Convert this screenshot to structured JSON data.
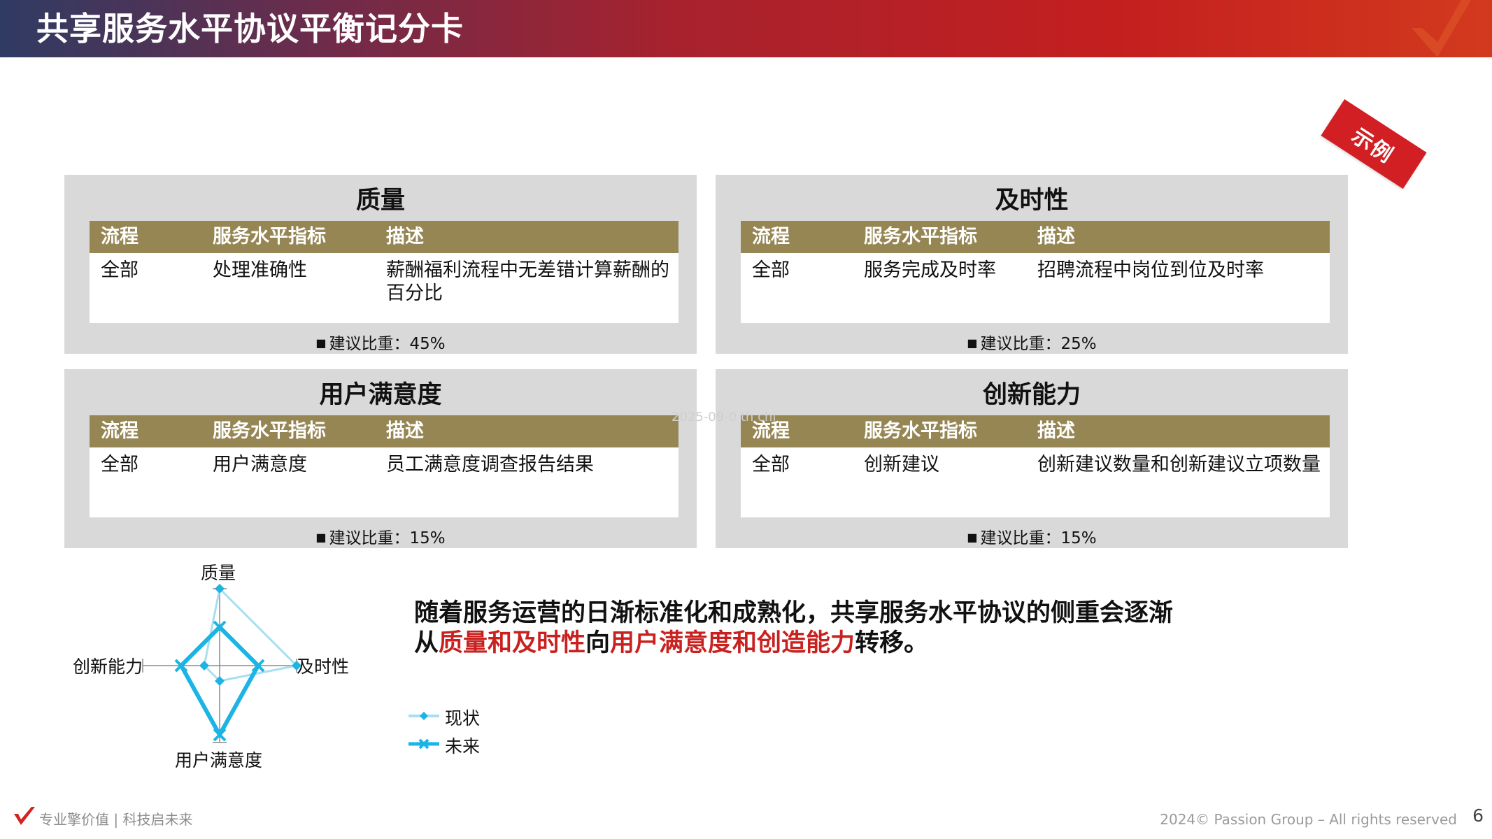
{
  "header": {
    "title": "共享服务水平协议平衡记分卡"
  },
  "stamp": {
    "label": "示例"
  },
  "columns": {
    "process": "流程",
    "indicator": "服务水平指标",
    "description": "描述"
  },
  "cards": [
    {
      "title": "质量",
      "process": "全部",
      "indicator": "处理准确性",
      "description": "薪酬福利流程中无差错计算薪酬的百分比",
      "weight": "建议比重：45%"
    },
    {
      "title": "及时性",
      "process": "全部",
      "indicator": "服务完成及时率",
      "description": "招聘流程中岗位到位及时率",
      "weight": "建议比重：25%"
    },
    {
      "title": "用户满意度",
      "process": "全部",
      "indicator": "用户满意度",
      "description": "员工满意度调查报告结果",
      "weight": "建议比重：15%"
    },
    {
      "title": "创新能力",
      "process": "全部",
      "indicator": "创新建议",
      "description": "创新建议数量和创新建议立项数量",
      "weight": "建议比重：15%"
    }
  ],
  "radar": {
    "axes": {
      "top": "质量",
      "right": "及时性",
      "bottom": "用户满意度",
      "left": "创新能力"
    },
    "series": [
      {
        "name": "现状",
        "color": "#a9def0",
        "marker": "diamond",
        "values": {
          "quality": 1.0,
          "timeliness": 1.0,
          "satisfaction": 0.2,
          "innovation": 0.2
        }
      },
      {
        "name": "未来",
        "color": "#1bb4e4",
        "marker": "x",
        "values": {
          "quality": 0.5,
          "timeliness": 0.5,
          "satisfaction": 0.9,
          "innovation": 0.5
        }
      }
    ]
  },
  "statement": {
    "line1": "随着服务运营的日渐标准化和成熟化，共享服务水平协议的侧重会逐渐",
    "line2_prefix": "从",
    "line2_red1": "质量和及时性",
    "line2_mid": "向",
    "line2_red2": "用户满意度和创造能力",
    "line2_suffix": "转移。"
  },
  "watermark": "2025-09-0 th    chi",
  "footer": {
    "slogan": "专业擎价值 | 科技启未来",
    "copyright": "2024© Passion Group – All rights reserved",
    "page_number": "6"
  },
  "colors": {
    "header_start": "#2f3b63",
    "header_end": "#c41f1f",
    "table_header": "#958654",
    "card_bg": "#d9d9d9",
    "accent_red": "#c8211f"
  }
}
